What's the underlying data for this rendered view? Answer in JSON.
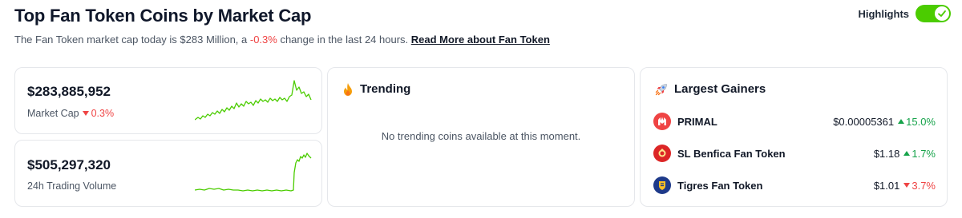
{
  "header": {
    "title": "Top Fan Token Coins by Market Cap",
    "subtitle_prefix": "The Fan Token market cap today is $283 Million, a ",
    "subtitle_change": "-0.3%",
    "subtitle_suffix": " change in the last 24 hours. ",
    "read_more": "Read More about Fan Token"
  },
  "highlights": {
    "label": "Highlights",
    "enabled": true
  },
  "market_cap": {
    "value": "$283,885,952",
    "label": "Market Cap",
    "change": "0.3%",
    "change_direction": "down",
    "spark_color": "#4bcc00"
  },
  "volume": {
    "value": "$505,297,320",
    "label": "24h Trading Volume",
    "spark_color": "#4bcc00"
  },
  "trending": {
    "title": "Trending",
    "icon": "fire-icon",
    "empty_message": "No trending coins available at this moment."
  },
  "gainers": {
    "title": "Largest Gainers",
    "icon": "rocket-icon",
    "items": [
      {
        "name": "PRIMAL",
        "price": "$0.00005361",
        "change": "15.0%",
        "direction": "up",
        "icon": "primal-icon",
        "color": "#ef4444"
      },
      {
        "name": "SL Benfica Fan Token",
        "price": "$1.18",
        "change": "1.7%",
        "direction": "up",
        "icon": "benfica-icon",
        "color": "#dc2626"
      },
      {
        "name": "Tigres Fan Token",
        "price": "$1.01",
        "change": "3.7%",
        "direction": "down",
        "icon": "tigres-icon",
        "color": "#1e3a8a"
      }
    ]
  },
  "colors": {
    "positive": "#16a34a",
    "negative": "#ef4444",
    "toggle": "#4bcc00"
  }
}
